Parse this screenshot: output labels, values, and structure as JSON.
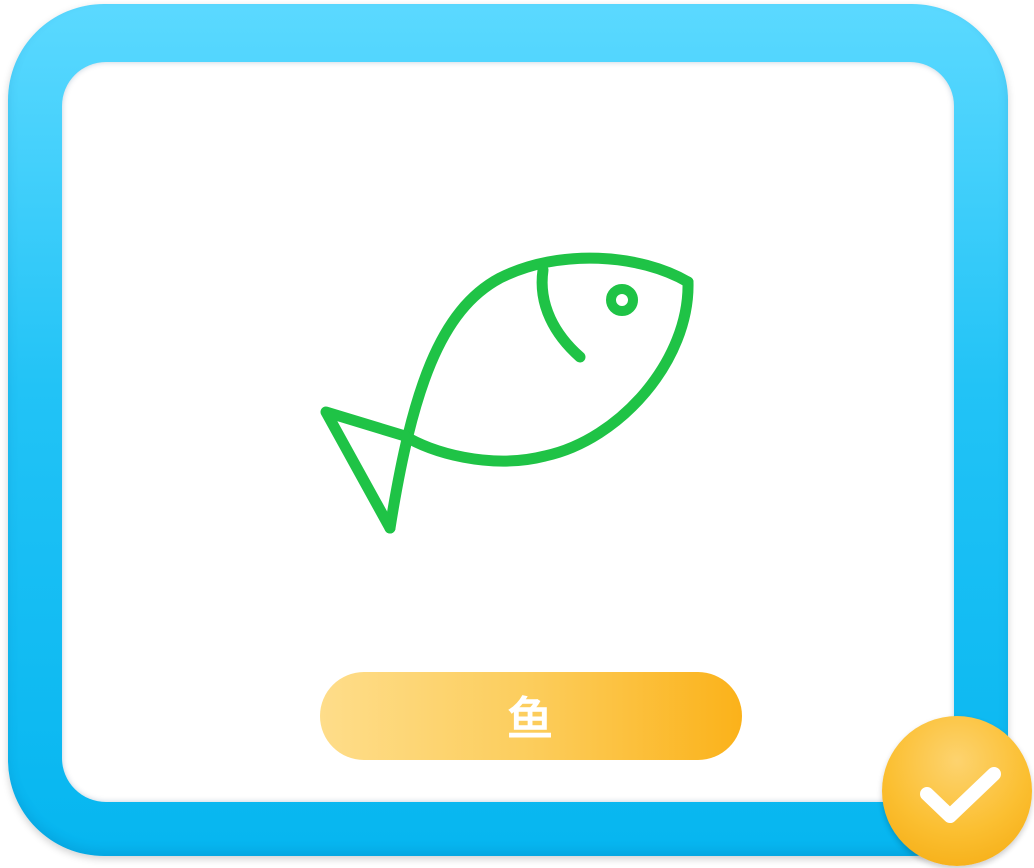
{
  "card": {
    "frame_color": "#22c3f6",
    "illustration": {
      "icon": "fish-icon",
      "stroke_color": "#1fc346"
    },
    "word_label": "鱼",
    "word_pill_color": "#fbb21a"
  },
  "status": {
    "icon": "checkmark-icon",
    "badge_color": "#fbbf31",
    "selected": true
  }
}
